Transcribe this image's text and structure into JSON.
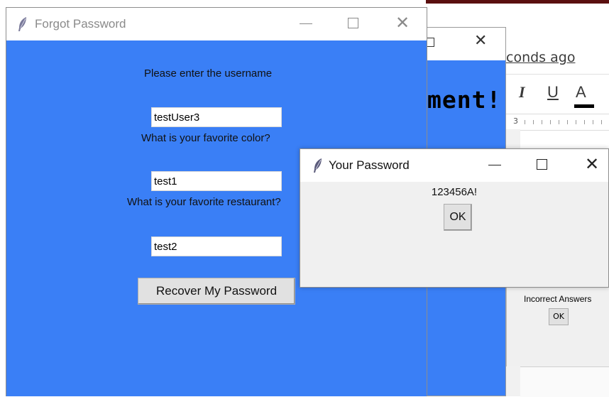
{
  "background_doc": {
    "link_text": "conds ago",
    "toolbar": {
      "italic": "I",
      "underline": "U",
      "font_color": "A"
    },
    "ruler_number": "3"
  },
  "middle_window": {
    "heading": "ment!",
    "incorrect_dialog": {
      "message": "Incorrect Answers",
      "ok": "OK"
    }
  },
  "forgot_password": {
    "title": "Forgot Password",
    "username_label": "Please enter the username",
    "username_value": "testUser3",
    "color_label": "What is your favorite color?",
    "color_value": "test1",
    "restaurant_label": "What is your favorite restaurant?",
    "restaurant_value": "test2",
    "button": "Recover My Password"
  },
  "your_password": {
    "title": "Your Password",
    "password": "123456A!",
    "ok": "OK"
  },
  "colors": {
    "window_blue": "#3a7ff6",
    "dialog_gray": "#f0f0f0"
  }
}
